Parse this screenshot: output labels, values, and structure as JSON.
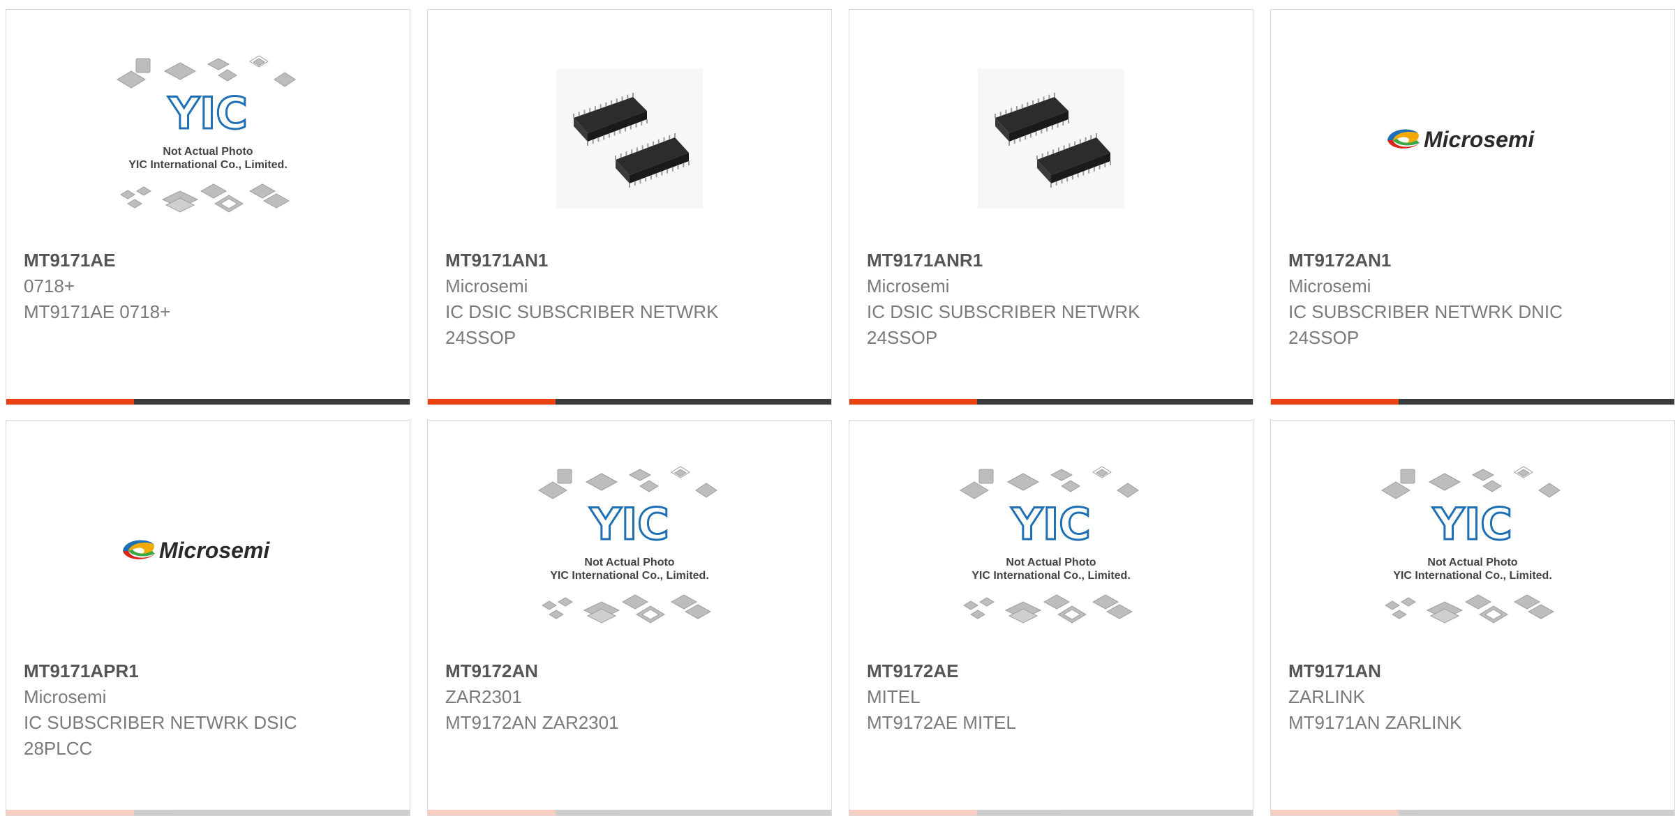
{
  "products": [
    {
      "part": "MT9171AE",
      "manufacturer": "0718+",
      "description": "MT9171AE 0718+",
      "image": "placeholder"
    },
    {
      "part": "MT9171AN1",
      "manufacturer": "Microsemi",
      "description": "IC DSIC SUBSCRIBER NETWRK 24SSOP",
      "image": "chips"
    },
    {
      "part": "MT9171ANR1",
      "manufacturer": "Microsemi",
      "description": "IC DSIC SUBSCRIBER NETWRK 24SSOP",
      "image": "chips"
    },
    {
      "part": "MT9172AN1",
      "manufacturer": "Microsemi",
      "description": "IC SUBSCRIBER NETWRK DNIC 24SSOP",
      "image": "logo"
    },
    {
      "part": "MT9171APR1",
      "manufacturer": "Microsemi",
      "description": "IC SUBSCRIBER NETWRK DSIC 28PLCC",
      "image": "logo"
    },
    {
      "part": "MT9172AN",
      "manufacturer": "ZAR2301",
      "description": "MT9172AN ZAR2301",
      "image": "placeholder"
    },
    {
      "part": "MT9172AE",
      "manufacturer": "MITEL",
      "description": "MT9172AE MITEL",
      "image": "placeholder"
    },
    {
      "part": "MT9171AN",
      "manufacturer": "ZARLINK",
      "description": "MT9171AN ZARLINK",
      "image": "placeholder"
    }
  ],
  "placeholder": {
    "logo_text": "YIC",
    "line1": "Not Actual Photo",
    "line2": "YIC International Co., Limited."
  },
  "brand_logo_text": "Microsemi",
  "colors": {
    "accent": "#e8400f",
    "bar": "#3a3b3d",
    "yic_blue": "#1f6fb5",
    "part_text": "#555555",
    "body_text": "#7a7a7a"
  }
}
